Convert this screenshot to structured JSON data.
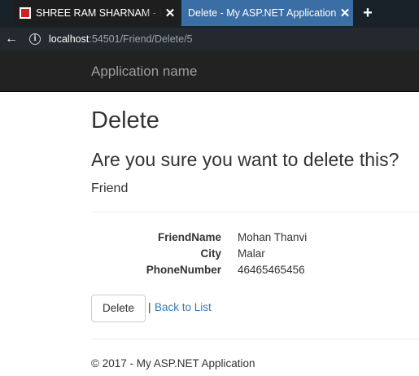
{
  "browser": {
    "tabs": [
      {
        "title": "SHREE RAM SHARNAM - Inte",
        "active": false,
        "close_label": "✕"
      },
      {
        "title": "Delete - My ASP.NET Application",
        "active": true,
        "close_label": "✕"
      }
    ],
    "new_tab_label": "+",
    "back_label": "←",
    "info_label": "i",
    "url_host": "localhost",
    "url_rest": ":54501/Friend/Delete/5"
  },
  "navbar": {
    "brand": "Application name"
  },
  "page": {
    "title": "Delete",
    "confirm": "Are you sure you want to delete this?",
    "entity": "Friend",
    "fields": [
      {
        "label": "FriendName",
        "value": "Mohan Thanvi"
      },
      {
        "label": "City",
        "value": "Malar"
      },
      {
        "label": "PhoneNumber",
        "value": "46465465456"
      }
    ],
    "delete_button": "Delete",
    "separator": "|",
    "back_link": "Back to List"
  },
  "footer": {
    "text": "© 2017 - My ASP.NET Application"
  },
  "colors": {
    "active_tab": "#3a6ea5",
    "navbar": "#222222",
    "link": "#337ab7"
  }
}
